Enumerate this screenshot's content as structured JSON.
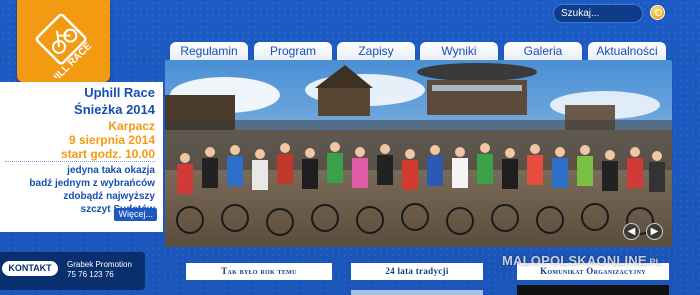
{
  "logo": {
    "text": "UPHILL RACE"
  },
  "search": {
    "placeholder": "Szukaj..."
  },
  "nav": [
    {
      "label": "Regulamin"
    },
    {
      "label": "Program"
    },
    {
      "label": "Zapisy"
    },
    {
      "label": "Wyniki"
    },
    {
      "label": "Galeria"
    },
    {
      "label": "Aktualności"
    }
  ],
  "sidebar": {
    "title_line1": "Uphill Race",
    "title_line2": "Śnieżka 2014",
    "place": "Karpacz",
    "date": "9 sierpnia 2014",
    "start": "start godz. 10.00",
    "text_line1": "jedyna taka okazja",
    "text_line2": "badź jednym z wybrańców",
    "text_line3": "zdobądź najwyższy",
    "text_line4": "szczyt Sudetów",
    "more": "Więcej..."
  },
  "photo": {
    "prev": "◀",
    "next": "▶"
  },
  "contact": {
    "button": "KONTAKT",
    "name": "Grabek Promotion",
    "phone": "75 76 123 76"
  },
  "boxes": [
    {
      "label": "Tak było rok temu"
    },
    {
      "label": "24 lata tradycji"
    },
    {
      "label": "Komunikat Organizacyjny"
    }
  ],
  "watermark": {
    "text": "MALOPOLSKAONLINE",
    "suffix": ".PL"
  },
  "colors": {
    "background": "#1b58c0",
    "accent": "#f39a13",
    "text_blue": "#174fb0",
    "dark_navy": "#0a2f6e"
  }
}
